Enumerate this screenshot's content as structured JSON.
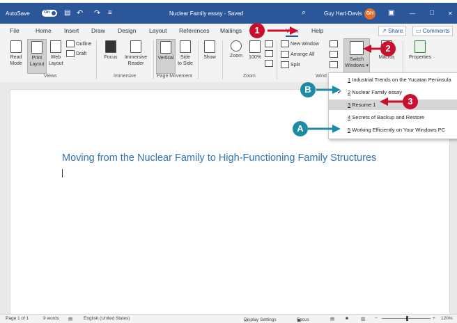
{
  "titlebar": {
    "autosave_label": "AutoSave",
    "autosave_state": "On",
    "doc_title": "Nuclear Family essay - Saved",
    "user_name": "Guy Hart-Davis",
    "user_initials": "GH",
    "undo_glyph": "↶",
    "redo_glyph": "↷",
    "save_glyph": "▤",
    "customize_glyph": "≡",
    "search_glyph": "⌕",
    "display_glyph": "▣",
    "minimize_glyph": "—",
    "maximize_glyph": "□",
    "close_glyph": "✕"
  },
  "tabs": [
    "File",
    "Home",
    "Insert",
    "Draw",
    "Design",
    "Layout",
    "References",
    "Mailings",
    "View",
    "Help"
  ],
  "share_label": "Share",
  "comments_label": "Comments",
  "ribbon": {
    "read_mode": [
      "Read",
      "Mode"
    ],
    "print_layout": [
      "Print",
      "Layout"
    ],
    "web_layout": [
      "Web",
      "Layout"
    ],
    "outline": "Outline",
    "draft": "Draft",
    "views_group": "Views",
    "focus": "Focus",
    "immersive_reader": [
      "Immersive",
      "Reader"
    ],
    "immersive_group": "Immersive",
    "vertical": "Vertical",
    "side_to_side": [
      "Side",
      "to Side"
    ],
    "page_movement_group": "Page Movement",
    "show": "Show",
    "zoom": "Zoom",
    "zoom_100": "100%",
    "zoom_group": "Zoom",
    "new_window": "New Window",
    "arrange_all": "Arrange All",
    "split": "Split",
    "window_group": "Wind",
    "switch_windows": [
      "Switch",
      "Windows"
    ],
    "macros": "Macros",
    "properties": "Properties"
  },
  "document": {
    "heading": "Moving from the Nuclear Family to High-Functioning Family Structures"
  },
  "switch_menu": {
    "items": [
      {
        "num": "1",
        "label": "Industrial Trends on the Yucatan Peninsula",
        "checked": false,
        "selected": false
      },
      {
        "num": "2",
        "label": "Nuclear Family essay",
        "checked": true,
        "selected": false
      },
      {
        "num": "3",
        "label": "Resume 1",
        "checked": false,
        "selected": true
      },
      {
        "num": "4",
        "label": "Secrets of Backup and Restore",
        "checked": false,
        "selected": false
      },
      {
        "num": "5",
        "label": "Working Efficiently on Your Windows PC",
        "checked": false,
        "selected": false
      }
    ]
  },
  "callouts": {
    "step1": "1",
    "step2": "2",
    "step3": "3",
    "a": "A",
    "b": "B"
  },
  "status": {
    "page": "Page 1 of 1",
    "words": "9 words",
    "language": "English (United States)",
    "display_settings": "Display Settings",
    "focus": "Focus",
    "zoom": "120%"
  },
  "colors": {
    "titlebar": "#2b579a",
    "heading": "#2e74b5",
    "callout_red": "#c8102e",
    "callout_teal": "#1d8aa6"
  }
}
